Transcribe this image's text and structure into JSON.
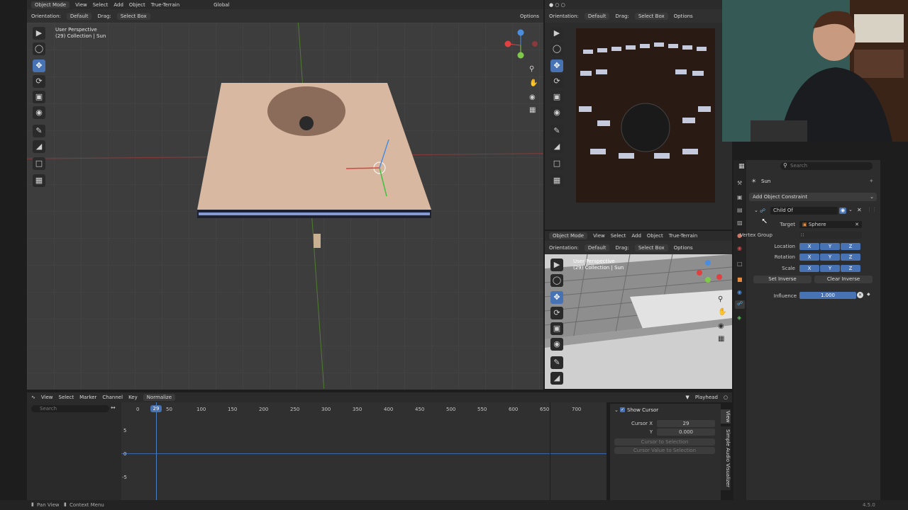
{
  "main_viewport": {
    "mode": "Object Mode",
    "menus": [
      "View",
      "Select",
      "Add",
      "Object",
      "True-Terrain"
    ],
    "transform": "Global",
    "orientation_label": "Orientation:",
    "orientation_value": "Default",
    "drag_label": "Drag:",
    "drag_value": "Select Box",
    "options": "Options",
    "overlay_title": "User Perspective",
    "overlay_sub": "(29) Collection | Sun"
  },
  "render_viewport": {
    "orientation_label": "Orientation:",
    "orientation_value": "Default",
    "drag_label": "Drag:",
    "drag_value": "Select Box",
    "options": "Options"
  },
  "side_viewport": {
    "mode": "Object Mode",
    "menus": [
      "View",
      "Select",
      "Add",
      "Object",
      "True-Terrain"
    ],
    "orientation_label": "Orientation:",
    "orientation_value": "Default",
    "drag_label": "Drag:",
    "drag_value": "Select Box",
    "options": "Options",
    "overlay_title": "User Perspective",
    "overlay_sub": "(29) Collection | Sun"
  },
  "properties": {
    "search_placeholder": "Search",
    "object_name": "Sun",
    "add_constraint": "Add Object Constraint",
    "constraint_name": "Child Of",
    "target_label": "Target",
    "target_value": "Sphere",
    "vertex_group_label": "Vertex Group",
    "location_label": "Location",
    "rotation_label": "Rotation",
    "scale_label": "Scale",
    "axes": [
      "X",
      "Y",
      "Z"
    ],
    "set_inverse": "Set Inverse",
    "clear_inverse": "Clear Inverse",
    "influence_label": "Influence",
    "influence_value": "1.000",
    "influence_fraction": 1.0
  },
  "graph_editor": {
    "menus": [
      "View",
      "Select",
      "Marker",
      "Channel",
      "Key"
    ],
    "normalize": "Normalize",
    "search_placeholder": "Search",
    "playhead_label": "Playhead",
    "current_frame": "29",
    "frame_ticks": [
      "0",
      "50",
      "100",
      "150",
      "200",
      "250",
      "300",
      "350",
      "400",
      "450",
      "500",
      "550",
      "600",
      "650",
      "700"
    ],
    "value_ticks": [
      "5",
      "0",
      "-5"
    ],
    "show_cursor": "Show Cursor",
    "cursor_x_label": "Cursor X",
    "cursor_x_value": "29",
    "cursor_y_label": "Y",
    "cursor_y_value": "0.000",
    "cursor_to_selection": "Cursor to Selection",
    "cursor_value_to_selection": "Cursor Value to Selection",
    "side_tabs": [
      "View",
      "Simple Audio Visualizer"
    ]
  },
  "status_bar": {
    "pan_view": "Pan View",
    "context_menu": "Context Menu",
    "version": "4.5.0"
  }
}
